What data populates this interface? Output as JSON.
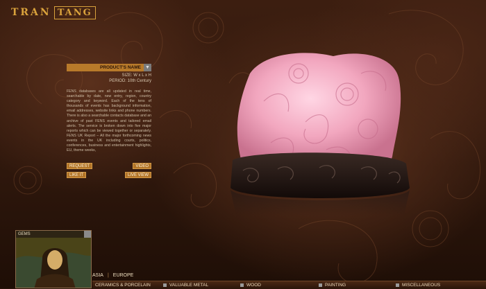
{
  "brand": {
    "name": "TRAN",
    "boxed": "TANG"
  },
  "product_panel": {
    "title": "PRODUCT'S NAME",
    "size": "SIZE: W x L x H",
    "period": "PERIOD: 10th Century",
    "description": "FENS databases are all updated in real time, searchable by date, new entry, region, country category and keyword. Each of the tens of thousands of events has background information, email addresses, website links and phone numbers. There is also a searchable contacts database and an archive of past FENS events and tailored email alerts. The service is broken down into five major reports which can be viewed together or separately.    FENS UK Report – All the major forthcoming news events in the UK including courts, politics, conferences, business and entertainment highlights, EU, theme weeks,",
    "buttons": {
      "request": "REQUEST",
      "video": "VIDEO",
      "like": "LIKE IT",
      "live_view": "LIVE VIEW"
    }
  },
  "gems": {
    "label": "GEMS"
  },
  "regions": {
    "asia": "ASIA",
    "separator": "|",
    "europe": "EUROPE"
  },
  "categories": [
    "CERAMICS & PORCELAIN",
    "VALUABLE METAL",
    "WOOD",
    "PAINTING",
    "MISCELLANEOUS"
  ],
  "colors": {
    "accent": "#b87a2a",
    "background": "#2e170c",
    "jade": "#f2a7bf"
  }
}
